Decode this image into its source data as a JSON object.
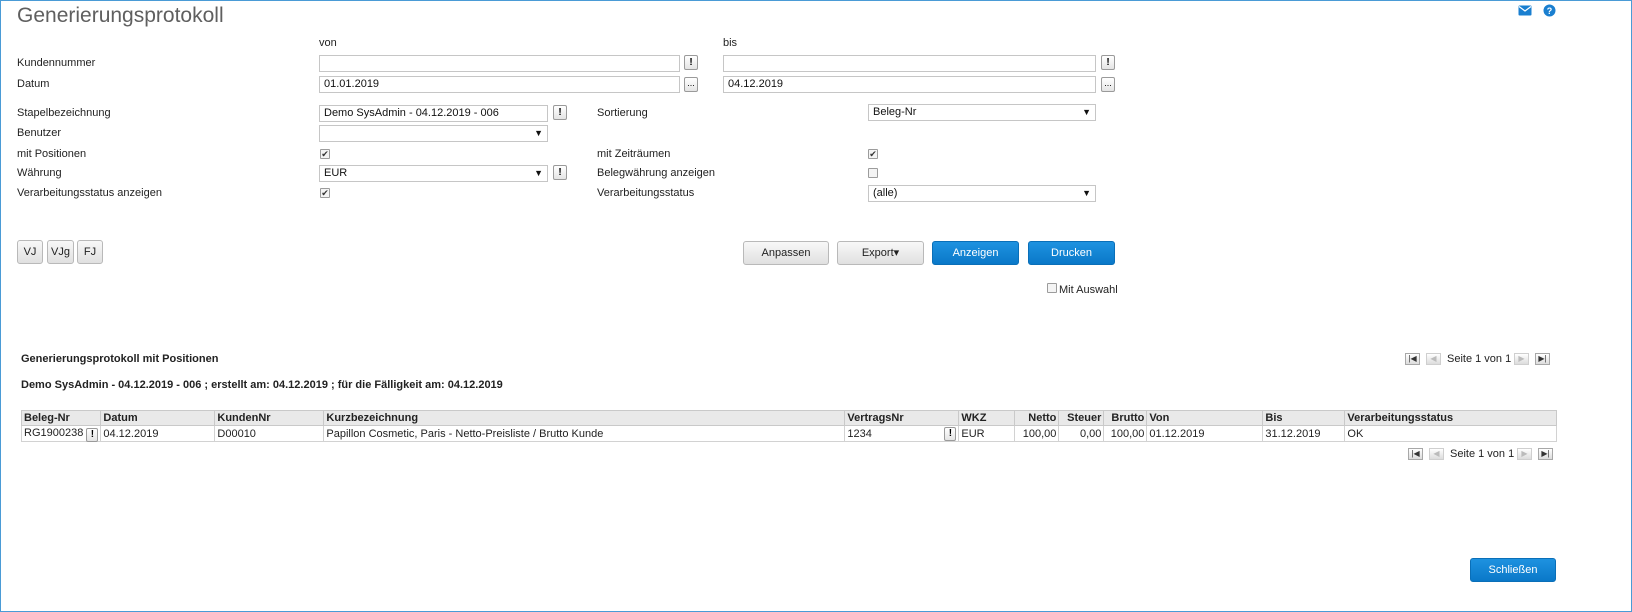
{
  "page": {
    "title": "Generierungsprotokoll"
  },
  "colors": {
    "accent": "#0a78c8",
    "border": "#4a9bd6"
  },
  "header_icons": [
    "mail-icon",
    "help-icon"
  ],
  "filters": {
    "col_von": "von",
    "col_bis": "bis",
    "kundennummer_label": "Kundennummer",
    "kundennummer_von": "",
    "kundennummer_bis": "",
    "datum_label": "Datum",
    "datum_von": "01.01.2019",
    "datum_bis": "04.12.2019",
    "stapel_label": "Stapelbezeichnung",
    "stapel_value": "Demo SysAdmin - 04.12.2019 - 006",
    "sortierung_label": "Sortierung",
    "sortierung_value": "Beleg-Nr",
    "benutzer_label": "Benutzer",
    "benutzer_value": "",
    "mit_positionen_label": "mit Positionen",
    "mit_positionen_checked": true,
    "mit_zeitraeumen_label": "mit Zeiträumen",
    "mit_zeitraeumen_checked": true,
    "waehrung_label": "Währung",
    "waehrung_value": "EUR",
    "belegwaehrung_label": "Belegwährung anzeigen",
    "belegwaehrung_checked": false,
    "verarb_anzeigen_label": "Verarbeitungsstatus anzeigen",
    "verarb_anzeigen_checked": true,
    "verarb_status_label": "Verarbeitungsstatus",
    "verarb_status_value": "(alle)",
    "exclaim": "!",
    "dots": "..."
  },
  "period_buttons": {
    "vj": "VJ",
    "vjg": "VJg",
    "fj": "FJ"
  },
  "actions": {
    "anpassen": "Anpassen",
    "export": "Export▾",
    "anzeigen": "Anzeigen",
    "drucken": "Drucken",
    "mit_auswahl": "Mit Auswahl"
  },
  "results": {
    "section_title": "Generierungsprotokoll mit Positionen",
    "group_header": "Demo SysAdmin - 04.12.2019 - 006 ; erstellt am: 04.12.2019 ; für die Fälligkeit am: 04.12.2019",
    "pager_text": "Seite 1 von 1",
    "columns": [
      "Beleg-Nr",
      "Datum",
      "KundenNr",
      "Kurzbezeichnung",
      "VertragsNr",
      "WKZ",
      "Netto",
      "Steuer",
      "Brutto",
      "Von",
      "Bis",
      "Verarbeitungsstatus"
    ],
    "rows": [
      {
        "beleg_nr": "RG1900238",
        "datum": "04.12.2019",
        "kunden_nr": "D00010",
        "kurzbezeichnung": "Papillon Cosmetic, Paris - Netto-Preisliste / Brutto Kunde",
        "vertrags_nr": "1234",
        "wkz": "EUR",
        "netto": "100,00",
        "steuer": "0,00",
        "brutto": "100,00",
        "von": "01.12.2019",
        "bis": "31.12.2019",
        "status": "OK"
      }
    ]
  },
  "footer": {
    "schliessen": "Schließen"
  }
}
